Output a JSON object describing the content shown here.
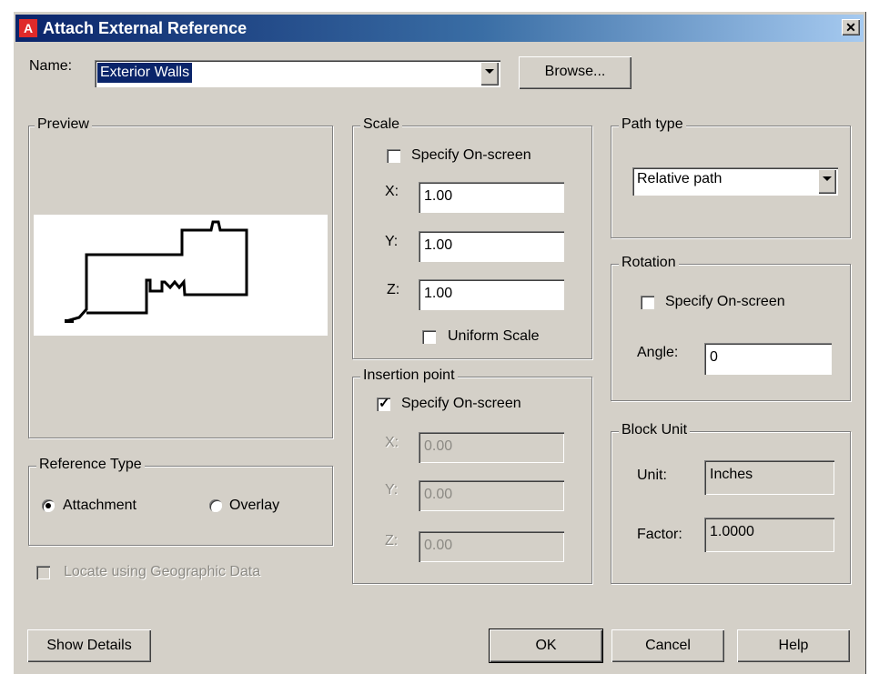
{
  "title": "Attach External Reference",
  "title_icon": "A",
  "close_glyph": "✕",
  "name": {
    "label": "Name:",
    "value": "Exterior Walls"
  },
  "browse_label": "Browse...",
  "preview": {
    "legend": "Preview"
  },
  "scale": {
    "legend": "Scale",
    "specify_onscreen": "Specify On-screen",
    "x_label": "X:",
    "x": "1.00",
    "y_label": "Y:",
    "y": "1.00",
    "z_label": "Z:",
    "z": "1.00",
    "uniform_scale": "Uniform Scale"
  },
  "path_type": {
    "legend": "Path type",
    "value": "Relative path"
  },
  "rotation": {
    "legend": "Rotation",
    "specify_onscreen": "Specify On-screen",
    "angle_label": "Angle:",
    "angle": "0"
  },
  "insertion_point": {
    "legend": "Insertion point",
    "specify_onscreen": "Specify On-screen",
    "checked": true,
    "x_label": "X:",
    "x": "0.00",
    "y_label": "Y:",
    "y": "0.00",
    "z_label": "Z:",
    "z": "0.00"
  },
  "block_unit": {
    "legend": "Block Unit",
    "unit_label": "Unit:",
    "unit": "Inches",
    "factor_label": "Factor:",
    "factor": "1.0000"
  },
  "reference_type": {
    "legend": "Reference Type",
    "attachment": "Attachment",
    "overlay": "Overlay",
    "selected": "Attachment"
  },
  "locate_geo": "Locate using Geographic Data",
  "buttons": {
    "show_details": "Show Details",
    "ok": "OK",
    "cancel": "Cancel",
    "help": "Help"
  },
  "colors": {
    "title_start": "#0a246a",
    "title_end": "#a6caf0",
    "face": "#d4d0c8"
  }
}
